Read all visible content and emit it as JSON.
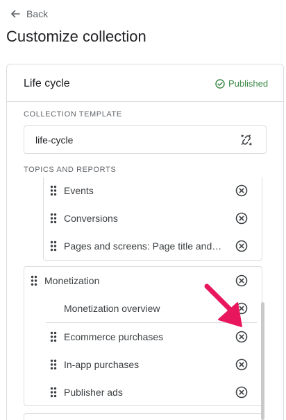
{
  "header": {
    "back_label": "Back",
    "title": "Customize collection"
  },
  "collection": {
    "name": "Life cycle",
    "status": "Published",
    "status_color": "#3c8a48",
    "template_label": "COLLECTION TEMPLATE",
    "template_value": "life-cycle",
    "topics_label": "TOPICS AND REPORTS"
  },
  "topics": {
    "first_group_items": [
      "Events",
      "Conversions",
      "Pages and screens: Page title and…"
    ],
    "monetization": {
      "name": "Monetization",
      "items": [
        "Monetization overview",
        "Ecommerce purchases",
        "In-app purchases",
        "Publisher ads"
      ]
    }
  },
  "accent_color": "#e8175d"
}
